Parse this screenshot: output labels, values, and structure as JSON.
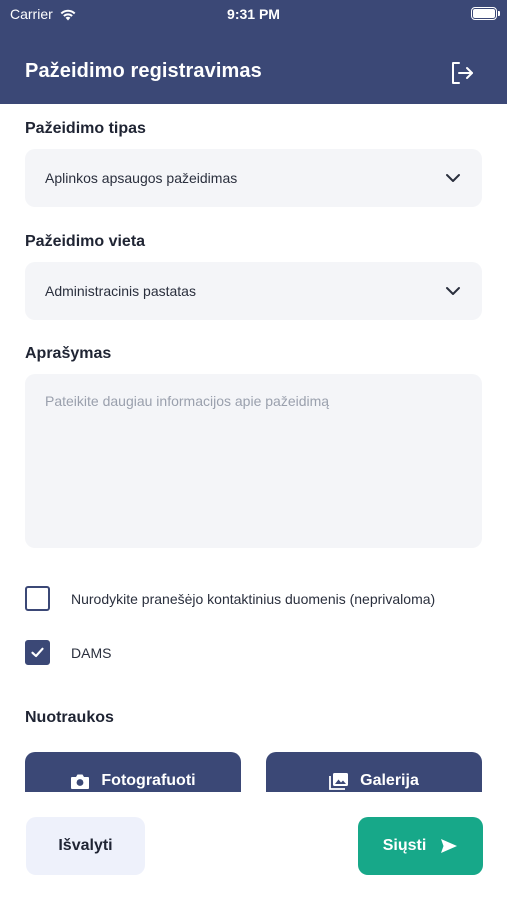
{
  "status_bar": {
    "carrier": "Carrier",
    "time": "9:31 PM",
    "icons": [
      "wifi-icon",
      "battery-icon"
    ]
  },
  "header": {
    "title": "Pažeidimo registravimas",
    "action_icon": "logout-icon",
    "background_color": "#3b4876"
  },
  "form": {
    "violation_type": {
      "label": "Pažeidimo tipas",
      "value": "Aplinkos apsaugos pažeidimas"
    },
    "violation_location": {
      "label": "Pažeidimo vieta",
      "value": "Administracinis pastatas"
    },
    "description": {
      "label": "Aprašymas",
      "value": "",
      "placeholder": "Pateikite daugiau informacijos apie pažeidimą"
    },
    "contact_checkbox": {
      "label": "Nurodykite pranešėjo kontaktinius duomenis (neprivaloma)",
      "checked": false
    },
    "dams_checkbox": {
      "label": "DAMS",
      "checked": true
    }
  },
  "photos": {
    "label": "Nuotraukos",
    "camera_button": "Fotografuoti",
    "gallery_button": "Galerija"
  },
  "actions": {
    "clear_label": "Išvalyti",
    "send_label": "Siųsti",
    "send_color": "#17a889"
  }
}
